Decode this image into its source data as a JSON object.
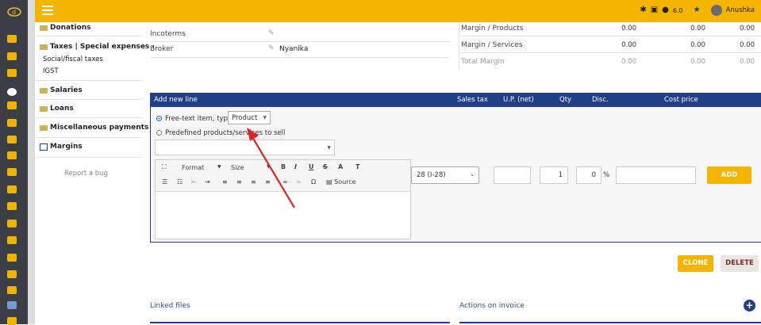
{
  "topbar": {
    "version": "6.0",
    "user": "Anushka"
  },
  "left_menu": {
    "items": [
      {
        "label": "Donations"
      },
      {
        "label": "Taxes | Special expenses"
      },
      {
        "label": "Social/fiscal taxes"
      },
      {
        "label": "IGST"
      },
      {
        "label": "Salaries"
      },
      {
        "label": "Loans"
      },
      {
        "label": "Miscellaneous payments"
      },
      {
        "label": "Margins"
      }
    ],
    "report_bug": "Report a bug"
  },
  "fields": {
    "incoterms_label": "Incoterms",
    "broker_label": "Broker",
    "broker_value": "Nyanika"
  },
  "margins_table": {
    "rows": [
      {
        "label": "Margin / Products",
        "v1": "0.00",
        "v2": "0.00",
        "v3": "0.00"
      },
      {
        "label": "Margin / Services",
        "v1": "0.00",
        "v2": "0.00",
        "v3": "0.00"
      },
      {
        "label": "Total Margin",
        "v1": "0.00",
        "v2": "0.00",
        "v3": "0.00"
      }
    ]
  },
  "line_table": {
    "headers": {
      "add_new_line": "Add new line",
      "sales_tax": "Sales tax",
      "up_net": "U.P. (net)",
      "qty": "Qty",
      "disc": "Disc.",
      "cost_price": "Cost price"
    }
  },
  "form": {
    "free_text_label": "Free-text item, type:",
    "type_value": "Product",
    "predefined_label": "Predefined products/services to sell",
    "editor": {
      "format": "Format",
      "size": "Size",
      "source": "Source"
    },
    "vat_value": "28 (I-28)",
    "qty_value": "1",
    "disc_value": "0",
    "pct": "%",
    "add_label": "ADD"
  },
  "actions": {
    "clone": "CLONE",
    "delete": "DELETE"
  },
  "sections": {
    "linked_files": "Linked files",
    "actions_on_invoice": "Actions on invoice"
  },
  "colors": {
    "accent": "#f4b400",
    "header_blue": "#213e86",
    "annotation_red": "#d9262c"
  }
}
